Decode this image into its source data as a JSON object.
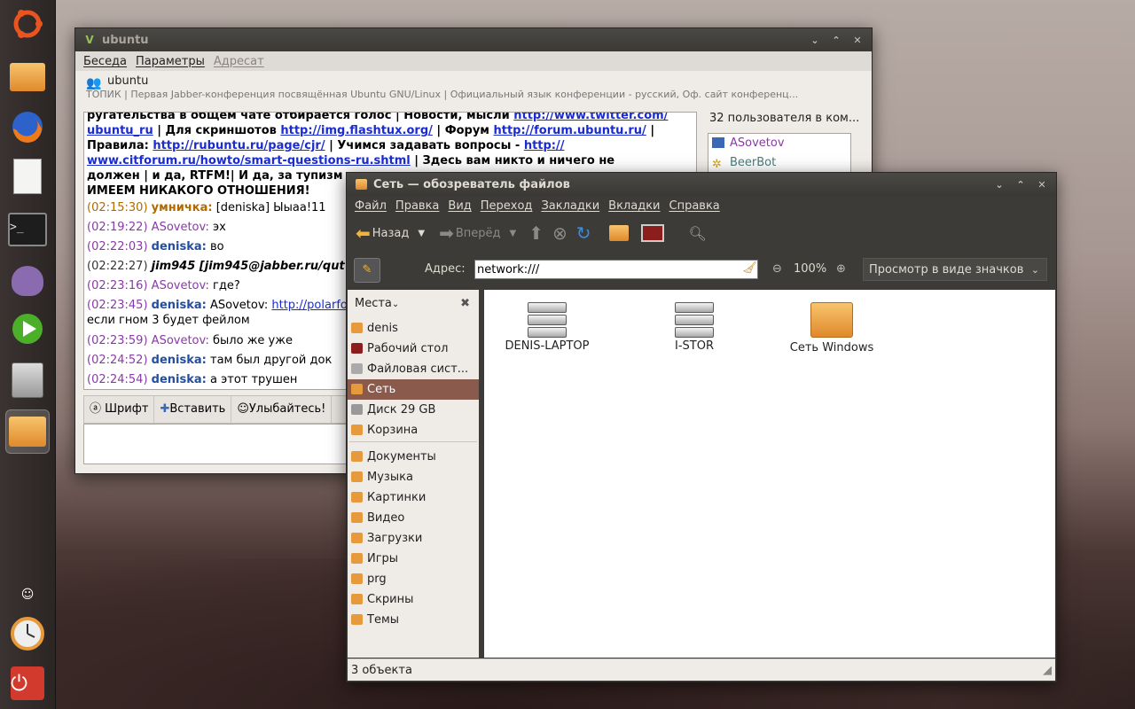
{
  "launcher": {
    "items": [
      "ubuntu-logo-icon",
      "folder-icon",
      "firefox-icon",
      "text-editor-icon",
      "terminal-icon",
      "pidgin-icon",
      "media-player-icon",
      "installer-icon",
      "home-folder-icon",
      "indicator-icon",
      "clock-icon",
      "power-icon"
    ]
  },
  "chat": {
    "title": "ubuntu",
    "menu": [
      "Беседа",
      "Параметры",
      "Адресат"
    ],
    "room": "ubuntu",
    "topic": "ТОПИК | Первая Jabber-конференция посвящённая Ubuntu GNU/Linux | Официальный язык конференции - русский, Оф. сайт конференц...",
    "log_head": [
      [
        "ругательства в общем чате отбирается голос | Новости, мысли ",
        "http://www.twitter.com/"
      ],
      [
        "",
        "ubuntu_ru",
        " | Для скриншотов ",
        "http://img.flashtux.org/",
        " | Форум ",
        "http://forum.ubuntu.ru/",
        " |"
      ],
      [
        "Правила: ",
        "http://rubuntu.ru/page/cjr/",
        " | Учимся задавать вопросы - ",
        "http://"
      ],
      [
        "",
        "www.citforum.ru/howto/smart-questions-ru.shtml",
        " | Здесь вам никто и ничего не"
      ],
      [
        "должен | и да, RTFM!| И да, за тупизм"
      ],
      [
        "ИМЕЕМ НИКАКОГО ОТНОШЕНИЯ!"
      ]
    ],
    "messages": [
      {
        "time": "(02:15:30)",
        "nick": "умничка:",
        "text": "[deniska] Ыыаа!11",
        "kind": "u"
      },
      {
        "time": "(02:19:22)",
        "nick": "ASovetov:",
        "text": "эх",
        "kind": "a"
      },
      {
        "time": "(02:22:03)",
        "nick": "deniska:",
        "text": "во",
        "kind": "d"
      },
      {
        "time": "(02:22:27)",
        "nick": "jim945 [jim945@jabber.ru/qut",
        "text": "",
        "kind": "k"
      },
      {
        "time": "(02:23:16)",
        "nick": "ASovetov:",
        "text": "где?",
        "kind": "a"
      },
      {
        "time": "(02:23:45)",
        "nick": "deniska:",
        "text": "ASovetov: ",
        "link": "http://polarfo",
        "kind": "d"
      },
      {
        "time": "",
        "nick": "",
        "text": "если гном 3 будет фейлом",
        "kind": "plain"
      },
      {
        "time": "(02:23:59)",
        "nick": "ASovetov:",
        "text": "было же уже",
        "kind": "a"
      },
      {
        "time": "(02:24:52)",
        "nick": "deniska:",
        "text": "там был другой док",
        "kind": "d"
      },
      {
        "time": "(02:24:54)",
        "nick": "deniska:",
        "text": "а этот трушен",
        "kind": "d"
      }
    ],
    "users_count": "32 пользователя в ком...",
    "users": [
      "ASovetov",
      "BeerBot"
    ],
    "toolbar": {
      "font": "Шрифт",
      "insert": "Вставить",
      "smile": "Улыбайтесь!"
    }
  },
  "fm": {
    "title": "Сеть — обозреватель файлов",
    "menu": [
      "Файл",
      "Правка",
      "Вид",
      "Переход",
      "Закладки",
      "Вкладки",
      "Справка"
    ],
    "back": "Назад",
    "forward": "Вперёд",
    "address_label": "Адрес:",
    "address": "network:///",
    "zoom": "100%",
    "view_mode": "Просмотр в виде значков",
    "places_label": "Места",
    "places": [
      {
        "label": "denis",
        "color": "#e69a3b"
      },
      {
        "label": "Рабочий стол",
        "color": "#8b1d1d"
      },
      {
        "label": "Файловая сист...",
        "color": "#aaaaaa"
      },
      {
        "label": "Сеть",
        "color": "#e69a3b",
        "selected": true
      },
      {
        "label": "Диск 29 GB",
        "color": "#999999"
      },
      {
        "label": "Корзина",
        "color": "#e69a3b"
      }
    ],
    "bookmarks": [
      "Документы",
      "Музыка",
      "Картинки",
      "Видео",
      "Загрузки",
      "Игры",
      "prg",
      "Скрины",
      "Темы"
    ],
    "items": [
      "DENIS-LAPTOP",
      "I-STOR",
      "Сеть Windows"
    ],
    "status": "3 объекта"
  }
}
